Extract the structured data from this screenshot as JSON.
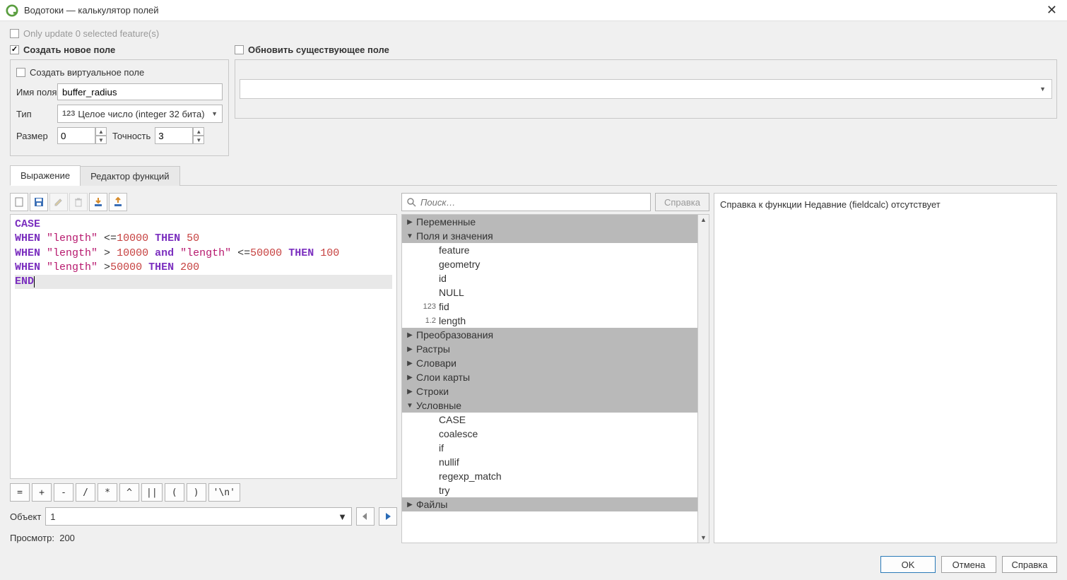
{
  "title": "Водотоки — калькулятор полей",
  "only_update_label": "Only update 0 selected feature(s)",
  "create_new": {
    "header": "Создать новое поле",
    "virtual_label": "Создать виртуальное поле",
    "name_label": "Имя поля",
    "name_value": "buffer_radius",
    "type_label": "Тип",
    "type_value": "Целое число (integer 32 бита)",
    "type_prefix": "123",
    "size_label": "Размер",
    "size_value": "0",
    "precision_label": "Точность",
    "precision_value": "3"
  },
  "update_existing": {
    "header": "Обновить существующее поле"
  },
  "tabs": {
    "expression": "Выражение",
    "functions": "Редактор функций"
  },
  "operators": [
    "=",
    "+",
    "-",
    "/",
    "*",
    "^",
    "||",
    "(",
    ")",
    "'\\n'"
  ],
  "feature": {
    "label": "Объект",
    "value": "1"
  },
  "preview": {
    "label": "Просмотр:",
    "value": "200"
  },
  "search": {
    "placeholder": "Поиск…"
  },
  "help_btn": "Справка",
  "tree": {
    "cat_vars": "Переменные",
    "cat_fields": "Поля и значения",
    "field_feature": "feature",
    "field_geometry": "geometry",
    "field_id": "id",
    "field_null": "NULL",
    "field_fid": "fid",
    "field_fid_type": "123",
    "field_length": "length",
    "field_length_type": "1.2",
    "cat_conv": "Преобразования",
    "cat_raster": "Растры",
    "cat_dict": "Словари",
    "cat_maplayers": "Слои карты",
    "cat_strings": "Строки",
    "cat_cond": "Условные",
    "cond_case": "CASE",
    "cond_coalesce": "coalesce",
    "cond_if": "if",
    "cond_nullif": "nullif",
    "cond_regexp": "regexp_match",
    "cond_try": "try",
    "cat_files": "Файлы"
  },
  "help_text": "Справка к функции Недавние (fieldcalc) отсутствует",
  "buttons": {
    "ok": "OK",
    "cancel": "Отмена",
    "help": "Справка"
  },
  "expression_tokens": {
    "case": "CASE",
    "when": "WHEN",
    "then": "THEN",
    "and": "and",
    "end": "END",
    "field": "\"length\"",
    "op1": " <=",
    "op2": " > ",
    "op3": " <=",
    "op4": " >",
    "n10000": "10000",
    "n50000": "50000",
    "n50": "50",
    "n100": "100",
    "n200": "200"
  }
}
